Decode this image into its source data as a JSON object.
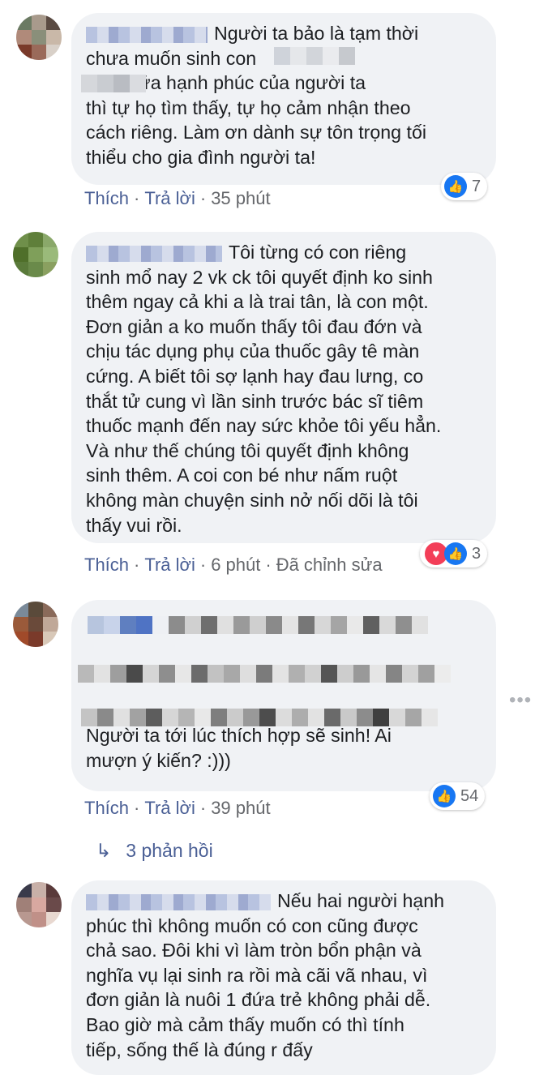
{
  "comments": [
    {
      "text": "Người ta bảo là tạm thời\nchưa muốn sinh con\n  Hơn nữa hạnh phúc của người ta\nthì tự họ tìm thấy, tự họ cảm nhận theo\ncách riêng. Làm ơn dành sự tôn trọng tối\nthiểu cho gia đình người ta!",
      "like": "Thích",
      "reply": "Trả lời",
      "time": "35 phút",
      "edited": "",
      "reaction_count": "7",
      "reaction_types": [
        "like-icon"
      ]
    },
    {
      "text": "Tôi từng có con riêng\nsinh mổ nay 2 vk ck tôi quyết định ko sinh\nthêm ngay cả khi a là trai tân, là con một.\nĐơn giản a ko muốn thấy tôi đau đớn và\nchịu tác dụng phụ của thuốc gây tê màn\ncứng. A biết tôi sợ lạnh hay đau lưng, co\nthắt tử cung vì lần sinh trước bác sĩ tiêm\nthuốc mạnh đến nay sức khỏe tôi yếu hẳn.\nVà như thế chúng tôi quyết định không\nsinh thêm. A coi con bé như nấm ruột\nkhông màn chuyện sinh nở nối dõi là tôi\nthấy vui rồi.",
      "like": "Thích",
      "reply": "Trả lời",
      "time": "6 phút",
      "edited": "Đã chỉnh sửa",
      "reaction_count": "3",
      "reaction_types": [
        "love-icon",
        "like-icon"
      ]
    },
    {
      "text": "Người ta tới lúc thích hợp sẽ sinh! Ai\nmượn ý kiến? :)))",
      "like": "Thích",
      "reply": "Trả lời",
      "time": "39 phút",
      "edited": "",
      "reaction_count": "54",
      "reaction_types": [
        "like-icon"
      ],
      "replies_label": "3 phản hồi"
    },
    {
      "text": "Nếu hai người hạnh\nphúc thì không muốn có con cũng được\nchả sao. Đôi khi vì làm tròn bổn phận và\nnghĩa vụ lại sinh ra rồi mà cãi vã nhau, vì\nđơn giản là nuôi 1 đứa trẻ không phải dễ.\nBao giờ mà cảm thấy muốn có thì tính\ntiếp, sống thế là đúng r đấy"
    }
  ],
  "colors": {
    "bubble": "#f0f2f5",
    "link": "#4a5f95",
    "like": "#1877f2",
    "love": "#f33e58"
  }
}
